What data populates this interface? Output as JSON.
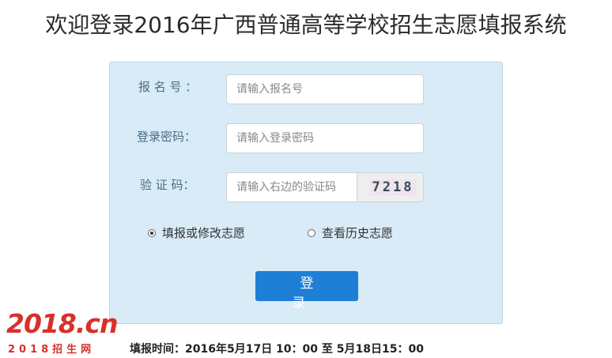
{
  "page": {
    "title": "欢迎登录2016年广西普通高等学校招生志愿填报系统"
  },
  "form": {
    "reg_no": {
      "label": "报 名 号 ：",
      "placeholder": "请输入报名号"
    },
    "password": {
      "label": "登录密码：",
      "placeholder": "请输入登录密码"
    },
    "captcha": {
      "label": "验 证 码：",
      "placeholder": "请输入右边的验证码",
      "code": "7218"
    },
    "options": [
      {
        "label": "填报或修改志愿",
        "checked": true
      },
      {
        "label": "查看历史志愿",
        "checked": false
      }
    ],
    "submit_label": "登 录"
  },
  "footer": {
    "schedule": "填报时间：2016年5月17日 10：00 至 5月18日15：00"
  },
  "watermark": {
    "main": "2018.cn",
    "sub": "2018招生网"
  },
  "colors": {
    "panel_bg": "#d8ebf6",
    "button": "#1f7fd6",
    "watermark": "#d9302a"
  }
}
